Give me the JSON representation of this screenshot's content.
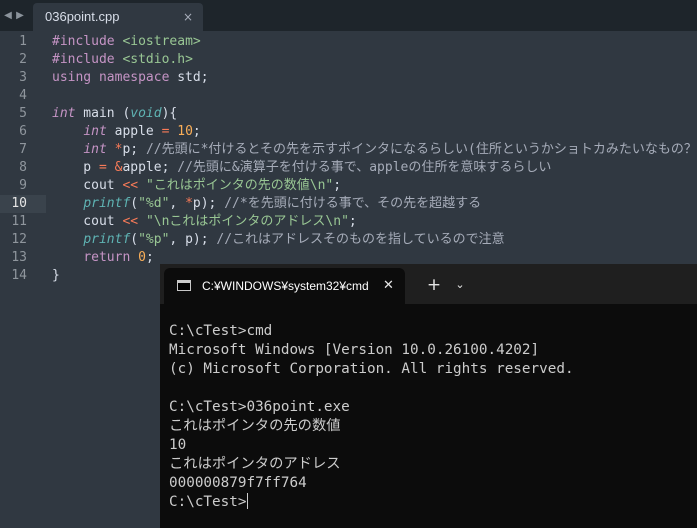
{
  "editor": {
    "nav_prev": "◀",
    "nav_next": "▶",
    "tab": {
      "title": "036point.cpp",
      "close": "×"
    },
    "current_line": 10,
    "line_numbers": [
      "1",
      "2",
      "3",
      "4",
      "5",
      "6",
      "7",
      "8",
      "9",
      "10",
      "11",
      "12",
      "13",
      "14"
    ],
    "lines": [
      [
        {
          "t": "#include ",
          "c": "k"
        },
        {
          "t": "<iostream>",
          "c": "g"
        }
      ],
      [
        {
          "t": "#include ",
          "c": "k"
        },
        {
          "t": "<stdio.h>",
          "c": "g"
        }
      ],
      [
        {
          "t": "using namespace ",
          "c": "k"
        },
        {
          "t": "std;",
          "c": "p"
        }
      ],
      [],
      [
        {
          "t": "int",
          "c": "k i"
        },
        {
          "t": " main ",
          "c": "p"
        },
        {
          "t": "(",
          "c": "p"
        },
        {
          "t": "void",
          "c": "b i"
        },
        {
          "t": "){",
          "c": "p"
        }
      ],
      [
        {
          "t": "    ",
          "c": "p"
        },
        {
          "t": "int",
          "c": "k i"
        },
        {
          "t": " apple ",
          "c": "p"
        },
        {
          "t": "=",
          "c": "o"
        },
        {
          "t": " ",
          "c": "p"
        },
        {
          "t": "10",
          "c": "n"
        },
        {
          "t": ";",
          "c": "p"
        }
      ],
      [
        {
          "t": "    ",
          "c": "p"
        },
        {
          "t": "int",
          "c": "k i"
        },
        {
          "t": " ",
          "c": "p"
        },
        {
          "t": "*",
          "c": "o"
        },
        {
          "t": "p; ",
          "c": "p"
        },
        {
          "t": "//先頭に*付けるとその先を示すポインタになるらしい(住所というかショトカみたいなもの？)",
          "c": "c"
        }
      ],
      [
        {
          "t": "    p ",
          "c": "p"
        },
        {
          "t": "=",
          "c": "o"
        },
        {
          "t": " ",
          "c": "p"
        },
        {
          "t": "&",
          "c": "o"
        },
        {
          "t": "apple; ",
          "c": "p"
        },
        {
          "t": "//先頭に&演算子を付ける事で、appleの住所を意味するらしい",
          "c": "c"
        }
      ],
      [
        {
          "t": "    cout ",
          "c": "p"
        },
        {
          "t": "<<",
          "c": "o"
        },
        {
          "t": " ",
          "c": "p"
        },
        {
          "t": "\"これはポインタの先の数値\\n\"",
          "c": "g"
        },
        {
          "t": ";",
          "c": "p"
        }
      ],
      [
        {
          "t": "    ",
          "c": "p"
        },
        {
          "t": "printf",
          "c": "b i"
        },
        {
          "t": "(",
          "c": "p"
        },
        {
          "t": "\"%d\"",
          "c": "g"
        },
        {
          "t": ", ",
          "c": "p"
        },
        {
          "t": "*",
          "c": "o"
        },
        {
          "t": "p); ",
          "c": "p"
        },
        {
          "t": "//*を先頭に付ける事で、その先を超越する",
          "c": "c"
        }
      ],
      [
        {
          "t": "    cout ",
          "c": "p"
        },
        {
          "t": "<<",
          "c": "o"
        },
        {
          "t": " ",
          "c": "p"
        },
        {
          "t": "\"\\nこれはポインタのアドレス\\n\"",
          "c": "g"
        },
        {
          "t": ";",
          "c": "p"
        }
      ],
      [
        {
          "t": "    ",
          "c": "p"
        },
        {
          "t": "printf",
          "c": "b i"
        },
        {
          "t": "(",
          "c": "p"
        },
        {
          "t": "\"%p\"",
          "c": "g"
        },
        {
          "t": ", p); ",
          "c": "p"
        },
        {
          "t": "//これはアドレスそのものを指しているので注意",
          "c": "c"
        }
      ],
      [
        {
          "t": "    ",
          "c": "p"
        },
        {
          "t": "return",
          "c": "k"
        },
        {
          "t": " ",
          "c": "p"
        },
        {
          "t": "0",
          "c": "n"
        },
        {
          "t": ";",
          "c": "p"
        }
      ],
      [
        {
          "t": "}",
          "c": "p"
        }
      ]
    ]
  },
  "terminal": {
    "tab_title": "C:¥WINDOWS¥system32¥cmd",
    "tab_close": "✕",
    "new_tab": "+",
    "dropdown": "⌄",
    "lines": [
      "C:\\cTest>cmd",
      "Microsoft Windows [Version 10.0.26100.4202]",
      "(c) Microsoft Corporation. All rights reserved.",
      "",
      "C:\\cTest>036point.exe",
      "これはポインタの先の数値",
      "10",
      "これはポインタのアドレス",
      "000000879f7ff764",
      "C:\\cTest>"
    ]
  },
  "colors": {
    "editor_bg": "#303841",
    "keyword": "#c594c5",
    "string": "#99c794",
    "number": "#f9ae58",
    "operator": "#f97b58",
    "builtin": "#5fb4b4",
    "comment": "#a6acb9",
    "terminal_bg": "#0c0c0c",
    "terminal_text": "#cccccc"
  }
}
